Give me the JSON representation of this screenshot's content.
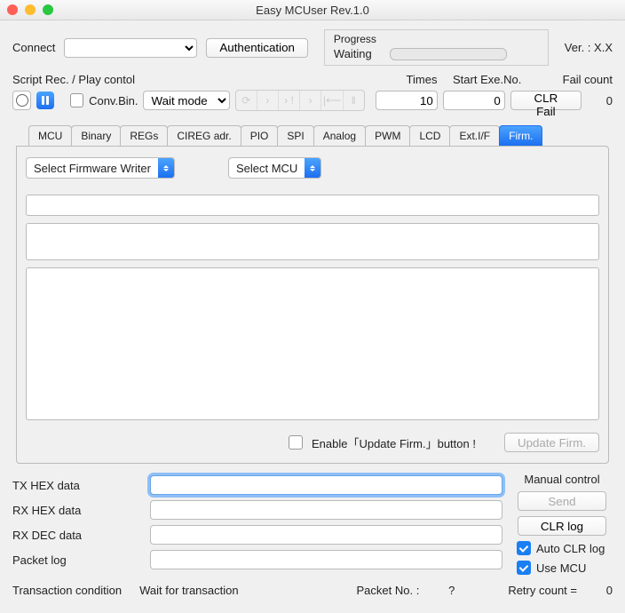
{
  "window_title": "Easy MCUser Rev.1.0",
  "connect_label": "Connect",
  "auth_button": "Authentication",
  "progress": {
    "label": "Progress",
    "status": "Waiting"
  },
  "version": "Ver. : X.X",
  "script_label": "Script Rec. / Play contol",
  "times_label": "Times",
  "start_exe_label": "Start Exe.No.",
  "fail_count_label": "Fail count",
  "conv_bin": "Conv.Bin.",
  "wait_mode": "Wait mode",
  "times_value": "10",
  "start_exe_value": "0",
  "clr_fail": "CLR Fail",
  "fail_count": "0",
  "tabs": [
    "MCU",
    "Binary",
    "REGs",
    "CIREG adr.",
    "PIO",
    "SPI",
    "Analog",
    "PWM",
    "LCD",
    "Ext.I/F",
    "Firm."
  ],
  "active_tab": 10,
  "fw_writer": "Select Firmware Writer",
  "mcu_select": "Select MCU",
  "enable_update": "Enable「Update Firm.」button !",
  "update_btn": "Update Firm.",
  "manual_control": "Manual control",
  "fields": {
    "txhex": "TX HEX data",
    "rxhex": "RX HEX data",
    "rxdec": "RX DEC data",
    "pktlog": "Packet log"
  },
  "send_btn": "Send",
  "clr_log": "CLR log",
  "auto_clr": "Auto CLR log",
  "use_mcu": "Use MCU",
  "trans_cond_label": "Transaction condition",
  "trans_cond_val": "Wait for transaction",
  "packet_no_label": "Packet No. :",
  "packet_no_val": "?",
  "retry_label": "Retry count  =",
  "retry_val": "0"
}
